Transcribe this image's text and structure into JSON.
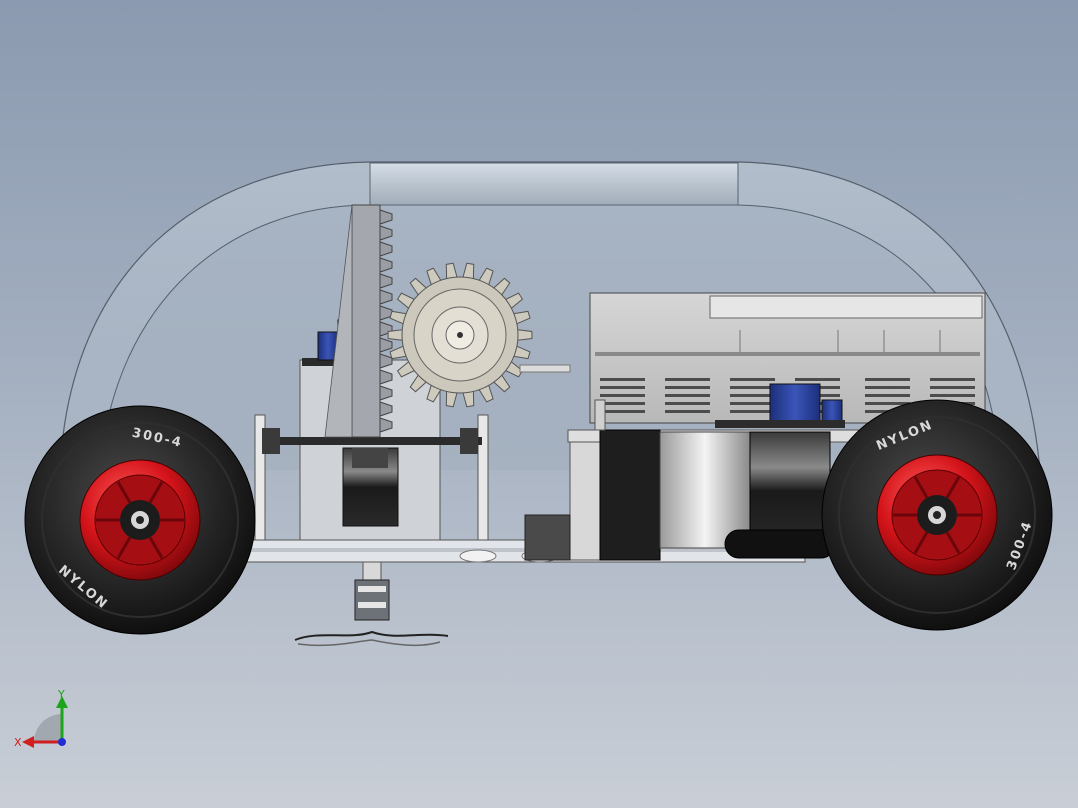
{
  "window": {
    "title": ""
  },
  "model": {
    "tire_brand": "NYLON",
    "tire_size": "300-4"
  },
  "triad": {
    "x_label": "X",
    "y_label": "Y",
    "x_color": "#d11f1f",
    "y_color": "#1aa51a",
    "z_color": "#1f2fd1"
  },
  "colors": {
    "rim": "#c8141a",
    "tire": "#1a1a1a",
    "gear": "#c9c4b8",
    "shell": "#b7c3cf",
    "frame": "#d8d8d8",
    "battery_blue": "#2a3f8f"
  }
}
